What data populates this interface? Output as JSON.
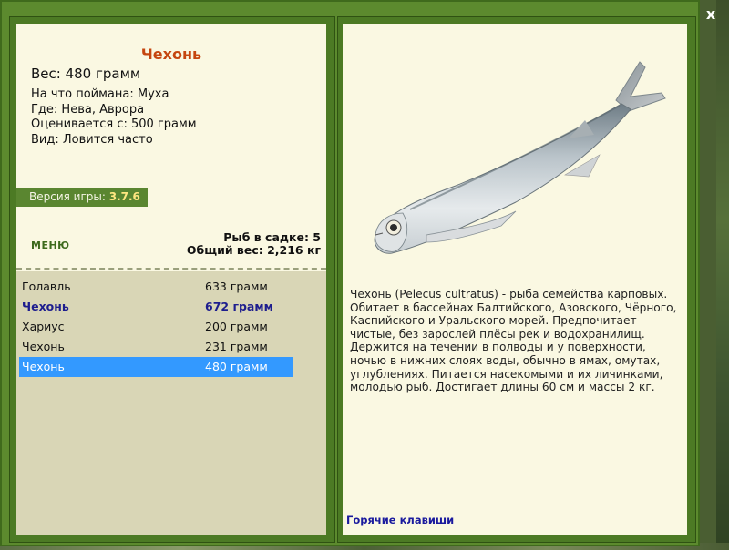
{
  "window": {
    "close_label": "x"
  },
  "fish": {
    "name": "Чехонь",
    "weight": "Вес: 480 грамм",
    "info": [
      "На что поймана: Муха",
      "Где: Нева, Аврора",
      "Оценивается с: 500 грамм",
      "Вид: Ловится часто"
    ],
    "description": "Чехонь (Pelecus cultratus) - рыба семейства карповых. Обитает в бассейнах Балтийского, Азовского, Чёрного, Каспийского и Уральского морей. Предпочитает чистые, без зарослей плёсы рек и водохранилищ. Держится на течении в полводы и у поверхности, ночью в нижних слоях воды, обычно в ямах, омутах, углублениях. Питается насекомыми и их личинками, молодью рыб. Достигает длины 60 см и массы 2 кг."
  },
  "version": {
    "label": "Версия игры:",
    "number": "3.7.6"
  },
  "menu": {
    "label": "МЕНЮ"
  },
  "keep": {
    "count_label": "Рыб в садке: 5",
    "total_label": "Общий вес: 2,216 кг"
  },
  "fish_list": [
    {
      "name": "Голавль",
      "weight": "633 грамм"
    },
    {
      "name": "Чехонь",
      "weight": "672 грамм"
    },
    {
      "name": "Хариус",
      "weight": "200 грамм"
    },
    {
      "name": "Чехонь",
      "weight": "231 грамм"
    },
    {
      "name": "Чехонь",
      "weight": "480 грамм"
    }
  ],
  "hotkeys": {
    "label": "Горячие клавиши"
  },
  "colors": {
    "frame": "#5c8a2e",
    "panel": "#faf8e2",
    "title": "#c5460f",
    "selection": "#3399ff",
    "best_entry": "#1e1e8e"
  }
}
